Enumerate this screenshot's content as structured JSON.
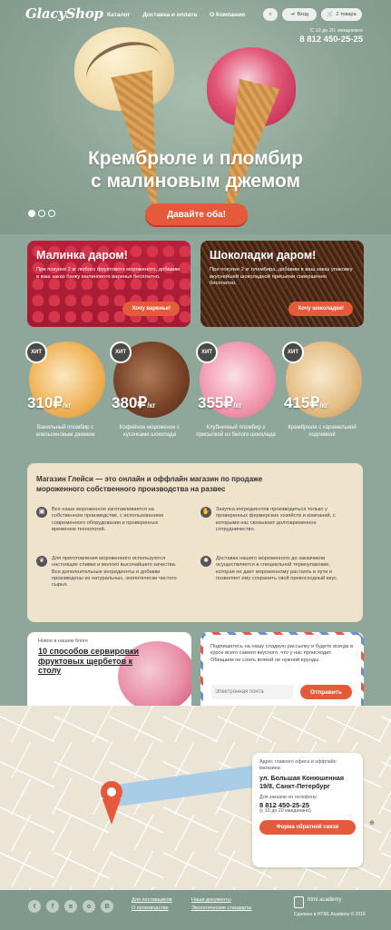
{
  "header": {
    "logo": "GlacyShop",
    "nav": [
      "Каталог",
      "Доставка и оплата",
      "О Компании"
    ],
    "search_icon": "search-icon",
    "login_label": "Вход",
    "cart_label": "2 товара",
    "phone_note": "С 10 до 20, ежедневно",
    "phone": "8 812 450-25-25"
  },
  "hero": {
    "title_line1": "Крембрюле и пломбир",
    "title_line2": "с малиновым джемом",
    "button": "Давайте оба!"
  },
  "promos": [
    {
      "title": "Малинка даром!",
      "text": "При покупке 2 кг любого фруктового мороженого, добавим в ваш заказ банку малинового варенья бесплатно.",
      "button": "Хочу варенье!"
    },
    {
      "title": "Шоколадки даром!",
      "text": "При покупке 2 кг пломбира, добавим в ваш заказ упаковку вкуснейшей шоколадной присыпки совершенно бесплатно.",
      "button": "Хочу шоколадки!"
    }
  ],
  "products": [
    {
      "hit": "ХИТ",
      "price": "310₽",
      "unit": "/кг",
      "name": "Ванильный пломбир с апельсиновым джемом"
    },
    {
      "hit": "ХИТ",
      "price": "380₽",
      "unit": "/кг",
      "name": "Кофейное мороженое с кусочками шоколада"
    },
    {
      "hit": "ХИТ",
      "price": "355₽",
      "unit": "/кг",
      "name": "Клубничный пломбир с присыпкой из белого шоколада"
    },
    {
      "hit": "ХИТ",
      "price": "415₽",
      "unit": "/кг",
      "name": "Крембрюле с карамельной подливкой"
    }
  ],
  "about": {
    "title": "Магазин Глейси  — это онлайн и оффлайн магазин по продаже мороженного собственного производства на развес",
    "features": [
      "Все наше мороженное изготавливается на собственном производстве, с использованием современного оборудования и проверенных временем технологий.",
      "Закупка ингредиентов производиться только у проверенных фермерских хозяйств и компаний, с которыми нас связывает долговременное сотрудничество.",
      "Для приготовления мороженного используются настоящие сливки и молоко высочайшего качества. Все дополнительные ингредиенты и добавки произведены из натуральных, экологически чистого сырья.",
      "Доставка нашего мороженного до заказчиков осуществляется в специальной термоупаковке, которая не дает мороженному растаять в пути и позволяет ему сохранить свой превосходный вкус."
    ]
  },
  "blog": {
    "tag": "Новое в нашем блоге",
    "title": "10 способов сервировки фруктовых щербетов к столу"
  },
  "subscribe": {
    "text": "Подпишитесь на нашу сладкую рассылку и будете всегда в курсе всего самого вкусного, что у нас происходит. Обещаем не слать всякой не нужной ерунды.",
    "placeholder": "Электронная почта",
    "button": "Отправить"
  },
  "contact": {
    "note": "Адрес главного офиса и оффлайн магазина:",
    "address": "ул. Большая Конюшенная 19/8, Санкт-Петербург",
    "phone_note": "Для заказов по телефону:",
    "phone": "8 812 450-25-25",
    "hours": "(с 10 до 20 ежедневно)",
    "button": "Форма обратной связи"
  },
  "footer": {
    "social": [
      "t",
      "f",
      "в",
      "o",
      "B"
    ],
    "links_col1": [
      "Для поставщиков",
      "О производстве"
    ],
    "links_col2": [
      "Наши документы",
      "Экологические стандарты"
    ],
    "academy": "html academy",
    "copyright": "Сделано в HTML Academy © 2016"
  }
}
